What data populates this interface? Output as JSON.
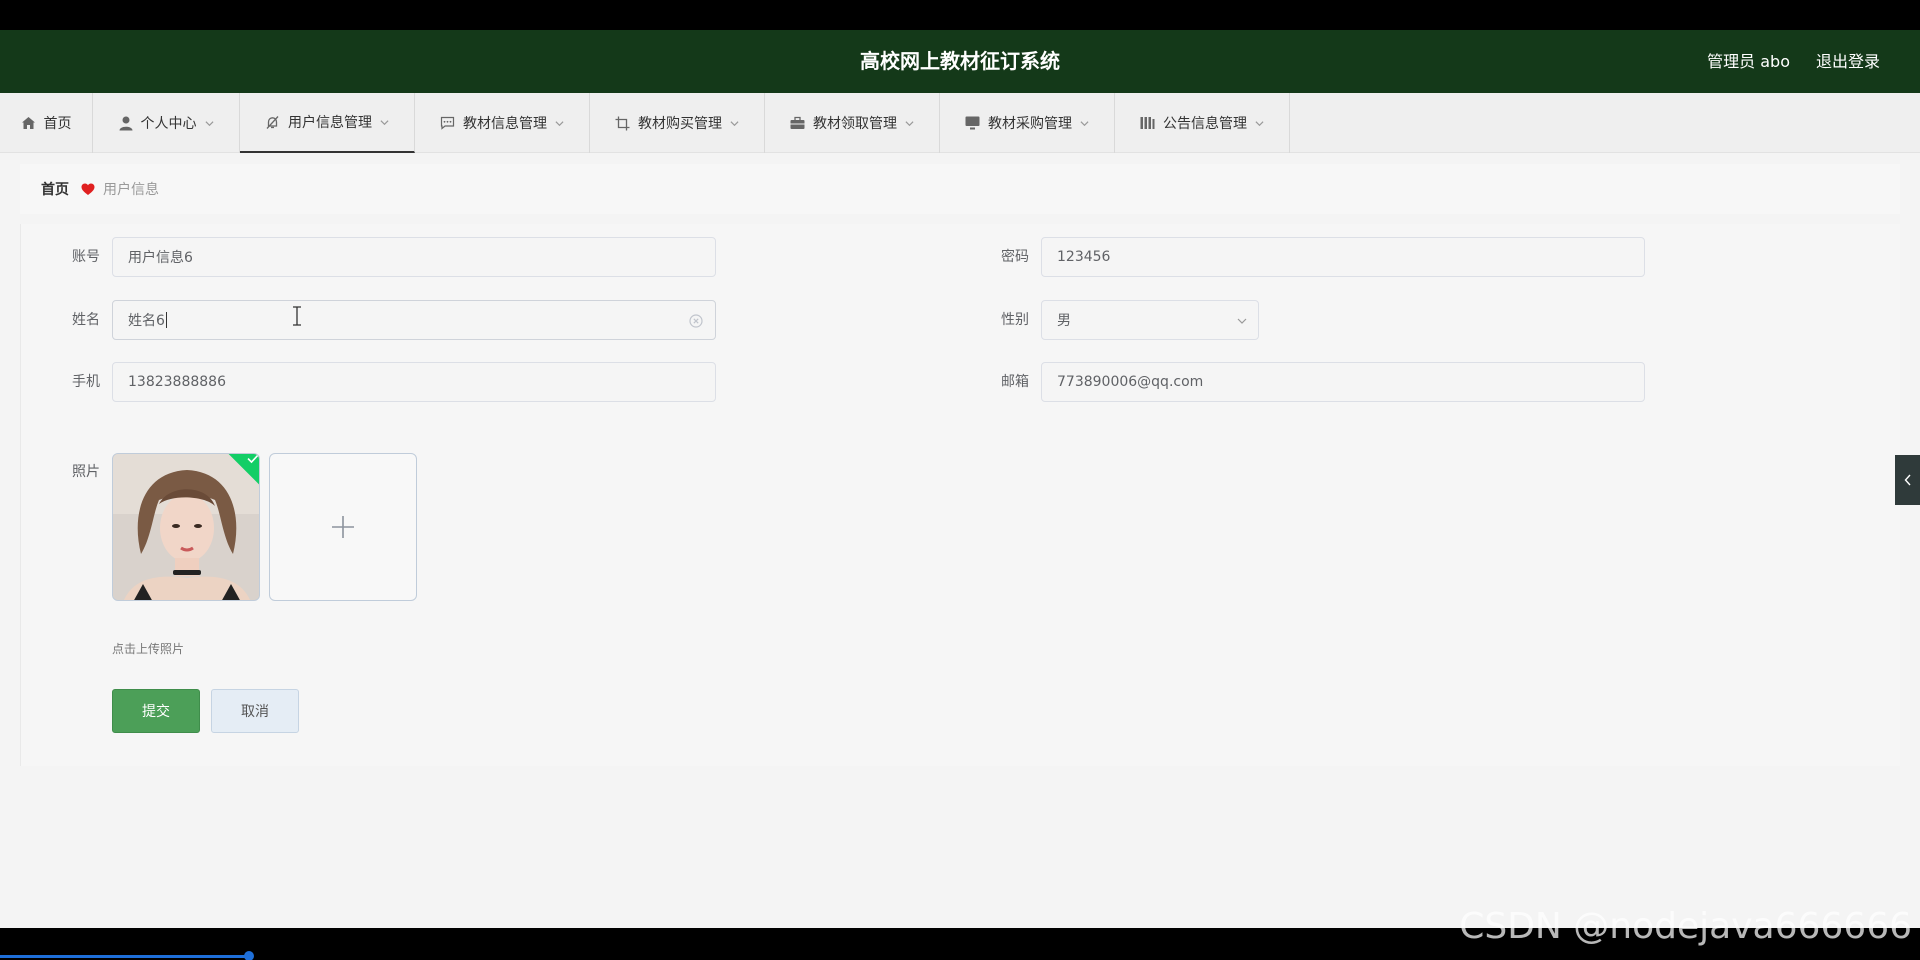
{
  "header": {
    "title": "高校网上教材征订系统",
    "admin": "管理员 abo",
    "logout": "退出登录"
  },
  "nav": {
    "items": [
      {
        "label": "首页",
        "icon": "home-icon"
      },
      {
        "label": "个人中心",
        "icon": "user-icon"
      },
      {
        "label": "用户信息管理",
        "icon": "bell-off-icon"
      },
      {
        "label": "教材信息管理",
        "icon": "chat-icon"
      },
      {
        "label": "教材购买管理",
        "icon": "crop-icon"
      },
      {
        "label": "教材领取管理",
        "icon": "briefcase-icon"
      },
      {
        "label": "教材采购管理",
        "icon": "monitor-icon"
      },
      {
        "label": "公告信息管理",
        "icon": "columns-icon"
      }
    ]
  },
  "breadcrumb": {
    "home": "首页",
    "current": "用户信息"
  },
  "form": {
    "account_label": "账号",
    "account_value": "用户信息6",
    "password_label": "密码",
    "password_value": "123456",
    "name_label": "姓名",
    "name_value": "姓名6",
    "gender_label": "性别",
    "gender_value": "男",
    "phone_label": "手机",
    "phone_value": "13823888886",
    "email_label": "邮箱",
    "email_value": "773890006@qq.com",
    "photo_label": "照片",
    "upload_hint": "点击上传照片",
    "submit": "提交",
    "cancel": "取消"
  },
  "watermark": "CSDN @nodejava666666",
  "colors": {
    "header_bg": "#143919",
    "primary_button": "#4c9f58",
    "upload_success": "#13ce66",
    "breadcrumb_heart": "#e02020"
  }
}
